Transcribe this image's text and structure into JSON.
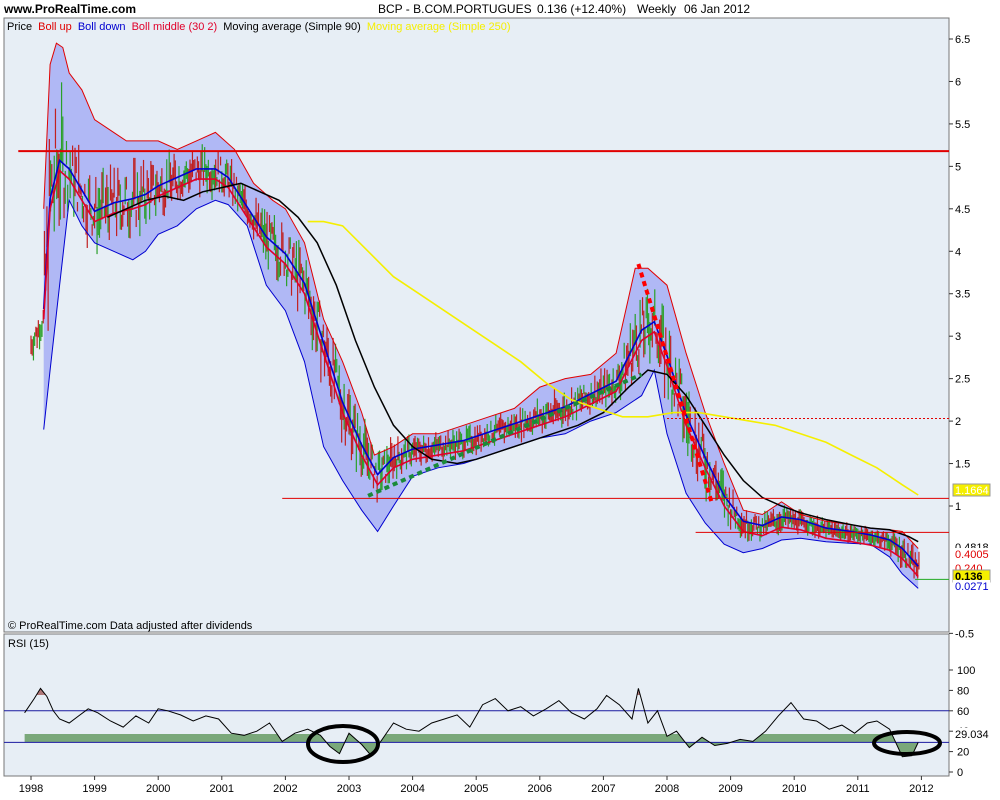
{
  "header": {
    "site": "www.ProRealTime.com",
    "symbol": "BCP - B.COM.PORTUGUES",
    "price_change": "0.136 (+12.40%)",
    "period": "Weekly",
    "date": "06 Jan 2012"
  },
  "legend": {
    "price": "Price",
    "boll_up": "Boll up",
    "boll_down": "Boll down",
    "boll_middle": "Boll middle (30 2)",
    "ma90": "Moving average (Simple 90)",
    "ma250": "Moving average (Simple 250)"
  },
  "watermark": "© ProRealTime.com  Data adjusted after dividends",
  "rsi_label": "RSI (15)",
  "colors": {
    "background": "#e7eef5",
    "band_fill": "#a6aef5",
    "boll_up": "#e00000",
    "boll_down": "#0000d0",
    "boll_middle": "#e0002a",
    "ma90": "#000000",
    "ma250": "#f5ef00",
    "trend_red": "#ff0000",
    "trend_green": "#1a8a3a",
    "support_line": "#e00000",
    "rsi_line": "#000000",
    "rsi_overbought_fill": "#b07878",
    "rsi_oversold_fill": "#7aa87a",
    "rsi_level": "#1a1aa0"
  },
  "chart_data": [
    {
      "type": "line",
      "title": "BCP - B.COM.PORTUGUES",
      "xlabel": "",
      "ylabel": "",
      "x_ticks": [
        "1998",
        "1999",
        "2000",
        "2001",
        "2002",
        "2003",
        "2004",
        "2005",
        "2006",
        "2007",
        "2008",
        "2009",
        "2010",
        "2011",
        "2012"
      ],
      "y_ticks": [
        -0.5,
        1,
        1.5,
        2,
        2.5,
        3,
        3.5,
        4,
        4.5,
        5,
        5.5,
        6,
        6.5
      ],
      "xlim": [
        1997.8,
        2012.3
      ],
      "ylim": [
        -0.5,
        6.7
      ],
      "horizontal_lines": [
        {
          "y": 5.18,
          "style": "solid",
          "from": 1997.8
        },
        {
          "y": 2.03,
          "style": "dotted",
          "from": 2008.0
        },
        {
          "y": 1.09,
          "style": "solid",
          "from": 2001.95
        },
        {
          "y": 0.69,
          "style": "solid",
          "from": 2008.45
        },
        {
          "y": 0.136,
          "style": "solid",
          "from": 2011.9,
          "color": "green"
        }
      ],
      "trendlines": [
        {
          "name": "green-uptrend",
          "points": [
            [
              2003.3,
              1.12
            ],
            [
              2007.6,
              2.55
            ]
          ]
        },
        {
          "name": "red-downtrend",
          "points": [
            [
              2007.55,
              3.85
            ],
            [
              2008.7,
              1.05
            ]
          ]
        }
      ],
      "value_labels": [
        {
          "text": "1.1664",
          "value": 1.1664
        },
        {
          "text": "0.4818",
          "value": 0.4818
        },
        {
          "text": "0.4005",
          "value": 0.4005
        },
        {
          "text": "0.240",
          "value": 0.24
        },
        {
          "text": "0.136",
          "value": 0.136
        },
        {
          "text": "0.0271",
          "value": 0.0271
        }
      ],
      "series": [
        {
          "name": "Boll up",
          "x": [
            1998.2,
            1998.3,
            1998.4,
            1998.5,
            1998.6,
            1998.8,
            1999.0,
            1999.3,
            1999.5,
            1999.8,
            2000.0,
            2000.3,
            2000.6,
            2000.9,
            2001.2,
            2001.5,
            2001.8,
            2002.0,
            2002.3,
            2002.6,
            2002.9,
            2003.2,
            2003.4,
            2003.7,
            2004.0,
            2004.4,
            2004.8,
            2005.2,
            2005.6,
            2006.0,
            2006.4,
            2006.8,
            2007.2,
            2007.5,
            2007.7,
            2008.0,
            2008.3,
            2008.6,
            2008.9,
            2009.2,
            2009.5,
            2009.8,
            2010.1,
            2010.5,
            2010.9,
            2011.2,
            2011.5,
            2011.7,
            2011.95
          ],
          "values": [
            4.5,
            6.2,
            6.45,
            6.4,
            6.1,
            5.9,
            5.55,
            5.4,
            5.3,
            5.3,
            5.3,
            5.2,
            5.3,
            5.4,
            5.2,
            4.8,
            4.6,
            4.5,
            4.1,
            3.2,
            2.7,
            2.1,
            1.6,
            1.7,
            1.85,
            1.85,
            1.95,
            2.05,
            2.15,
            2.4,
            2.5,
            2.55,
            2.8,
            3.8,
            3.8,
            3.6,
            2.8,
            2.1,
            1.5,
            0.95,
            0.9,
            1.05,
            0.9,
            0.82,
            0.78,
            0.74,
            0.72,
            0.7,
            0.5
          ]
        },
        {
          "name": "Boll middle (30 2)",
          "x": [
            1998.2,
            1998.3,
            1998.45,
            1998.6,
            1998.8,
            1999.0,
            1999.3,
            1999.6,
            1999.8,
            2000.0,
            2000.3,
            2000.6,
            2000.9,
            2001.1,
            2001.4,
            2001.7,
            2002.0,
            2002.3,
            2002.6,
            2002.9,
            2003.2,
            2003.45,
            2003.7,
            2004.0,
            2004.4,
            2004.8,
            2005.2,
            2005.6,
            2006.0,
            2006.4,
            2006.8,
            2007.2,
            2007.6,
            2007.8,
            2008.0,
            2008.3,
            2008.6,
            2008.9,
            2009.2,
            2009.5,
            2009.8,
            2010.1,
            2010.5,
            2010.9,
            2011.2,
            2011.5,
            2011.7,
            2011.95
          ],
          "values": [
            3.3,
            4.6,
            5.05,
            4.95,
            4.7,
            4.45,
            4.55,
            4.6,
            4.65,
            4.75,
            4.85,
            4.95,
            4.95,
            4.85,
            4.5,
            4.15,
            3.95,
            3.6,
            2.9,
            2.2,
            1.7,
            1.35,
            1.55,
            1.65,
            1.7,
            1.75,
            1.85,
            1.95,
            2.05,
            2.15,
            2.3,
            2.45,
            3.05,
            3.15,
            2.75,
            2.05,
            1.55,
            1.1,
            0.8,
            0.75,
            0.85,
            0.82,
            0.72,
            0.68,
            0.64,
            0.58,
            0.48,
            0.27
          ]
        },
        {
          "name": "Boll down",
          "x": [
            1998.2,
            1998.3,
            1998.45,
            1998.6,
            1998.8,
            1999.0,
            1999.3,
            1999.6,
            1999.8,
            2000.0,
            2000.3,
            2000.6,
            2000.9,
            2001.1,
            2001.4,
            2001.7,
            2002.0,
            2002.3,
            2002.6,
            2002.9,
            2003.2,
            2003.45,
            2003.7,
            2004.0,
            2004.4,
            2004.8,
            2005.2,
            2005.6,
            2006.0,
            2006.4,
            2006.8,
            2007.2,
            2007.6,
            2007.8,
            2008.0,
            2008.3,
            2008.6,
            2008.9,
            2009.2,
            2009.5,
            2009.8,
            2010.1,
            2010.5,
            2010.9,
            2011.2,
            2011.5,
            2011.7,
            2011.95
          ],
          "values": [
            1.9,
            2.6,
            3.6,
            4.6,
            4.3,
            4.1,
            4.0,
            3.9,
            4.0,
            4.2,
            4.3,
            4.5,
            4.6,
            4.55,
            4.3,
            3.6,
            3.3,
            2.7,
            1.7,
            1.3,
            0.95,
            0.7,
            1.0,
            1.35,
            1.45,
            1.5,
            1.6,
            1.7,
            1.8,
            1.85,
            2.0,
            2.1,
            2.3,
            2.6,
            1.85,
            1.15,
            0.8,
            0.55,
            0.45,
            0.5,
            0.6,
            0.62,
            0.58,
            0.56,
            0.55,
            0.4,
            0.2,
            0.03
          ]
        },
        {
          "name": "Moving average (Simple 90)",
          "x": [
            1999.2,
            1999.5,
            1999.8,
            2000.1,
            2000.4,
            2000.7,
            2001.0,
            2001.3,
            2001.6,
            2001.9,
            2002.2,
            2002.5,
            2002.8,
            2003.1,
            2003.4,
            2003.7,
            2004.0,
            2004.3,
            2004.7,
            2005.0,
            2005.4,
            2005.8,
            2006.2,
            2006.6,
            2007.0,
            2007.4,
            2007.7,
            2008.0,
            2008.3,
            2008.6,
            2008.9,
            2009.2,
            2009.5,
            2009.8,
            2010.1,
            2010.5,
            2010.9,
            2011.2,
            2011.5,
            2011.8,
            2011.95
          ],
          "values": [
            4.4,
            4.5,
            4.6,
            4.65,
            4.6,
            4.7,
            4.75,
            4.8,
            4.7,
            4.6,
            4.4,
            4.1,
            3.6,
            2.95,
            2.4,
            1.95,
            1.7,
            1.55,
            1.5,
            1.55,
            1.65,
            1.75,
            1.85,
            1.95,
            2.1,
            2.4,
            2.6,
            2.55,
            2.3,
            1.95,
            1.6,
            1.3,
            1.1,
            1.0,
            0.92,
            0.84,
            0.78,
            0.74,
            0.72,
            0.64,
            0.58
          ]
        },
        {
          "name": "Moving average (Simple 250)",
          "x": [
            2002.35,
            2002.6,
            2002.9,
            2003.3,
            2003.7,
            2004.1,
            2004.5,
            2004.9,
            2005.3,
            2005.7,
            2006.1,
            2006.5,
            2006.9,
            2007.3,
            2007.7,
            2008.1,
            2008.5,
            2008.9,
            2009.3,
            2009.7,
            2010.1,
            2010.5,
            2010.9,
            2011.3,
            2011.7,
            2011.95
          ],
          "values": [
            4.35,
            4.35,
            4.3,
            4.0,
            3.7,
            3.5,
            3.3,
            3.1,
            2.9,
            2.7,
            2.45,
            2.25,
            2.15,
            2.05,
            2.05,
            2.1,
            2.1,
            2.05,
            2.0,
            1.95,
            1.85,
            1.75,
            1.6,
            1.45,
            1.25,
            1.13
          ]
        }
      ]
    },
    {
      "type": "line",
      "title": "RSI (15)",
      "y_ticks": [
        0,
        20,
        40,
        60,
        80,
        100
      ],
      "ylim": [
        -5,
        105
      ],
      "levels": [
        60,
        29.034
      ],
      "last_value_label": "29.034",
      "annotations": [
        "oval around 2003 oversold dip",
        "oval around 2011.7 oversold dip"
      ],
      "series": [
        {
          "name": "RSI (15)",
          "x": [
            1997.9,
            1998.05,
            1998.15,
            1998.25,
            1998.35,
            1998.45,
            1998.6,
            1998.75,
            1998.9,
            1999.05,
            1999.25,
            1999.45,
            1999.65,
            1999.85,
            2000.0,
            2000.15,
            2000.35,
            2000.55,
            2000.75,
            2000.95,
            2001.15,
            2001.35,
            2001.55,
            2001.75,
            2001.95,
            2002.15,
            2002.35,
            2002.55,
            2002.7,
            2002.85,
            2003.0,
            2003.2,
            2003.35,
            2003.5,
            2003.7,
            2003.9,
            2004.1,
            2004.3,
            2004.5,
            2004.7,
            2004.9,
            2005.1,
            2005.3,
            2005.5,
            2005.7,
            2005.9,
            2006.1,
            2006.3,
            2006.5,
            2006.7,
            2006.9,
            2007.05,
            2007.25,
            2007.45,
            2007.55,
            2007.7,
            2007.85,
            2008.0,
            2008.15,
            2008.35,
            2008.55,
            2008.75,
            2008.95,
            2009.15,
            2009.35,
            2009.55,
            2009.75,
            2009.95,
            2010.15,
            2010.35,
            2010.55,
            2010.75,
            2010.95,
            2011.15,
            2011.3,
            2011.5,
            2011.7,
            2011.85,
            2011.95
          ],
          "values": [
            58,
            72,
            82,
            74,
            60,
            52,
            48,
            55,
            62,
            58,
            50,
            44,
            55,
            48,
            62,
            60,
            56,
            50,
            55,
            52,
            38,
            36,
            40,
            48,
            30,
            38,
            42,
            36,
            25,
            18,
            38,
            27,
            16,
            30,
            48,
            42,
            40,
            48,
            52,
            56,
            44,
            66,
            72,
            60,
            64,
            55,
            62,
            70,
            58,
            52,
            62,
            75,
            66,
            52,
            82,
            48,
            60,
            35,
            40,
            24,
            34,
            26,
            28,
            32,
            30,
            40,
            55,
            68,
            52,
            50,
            42,
            46,
            38,
            48,
            50,
            42,
            15,
            16,
            29
          ]
        }
      ]
    }
  ]
}
